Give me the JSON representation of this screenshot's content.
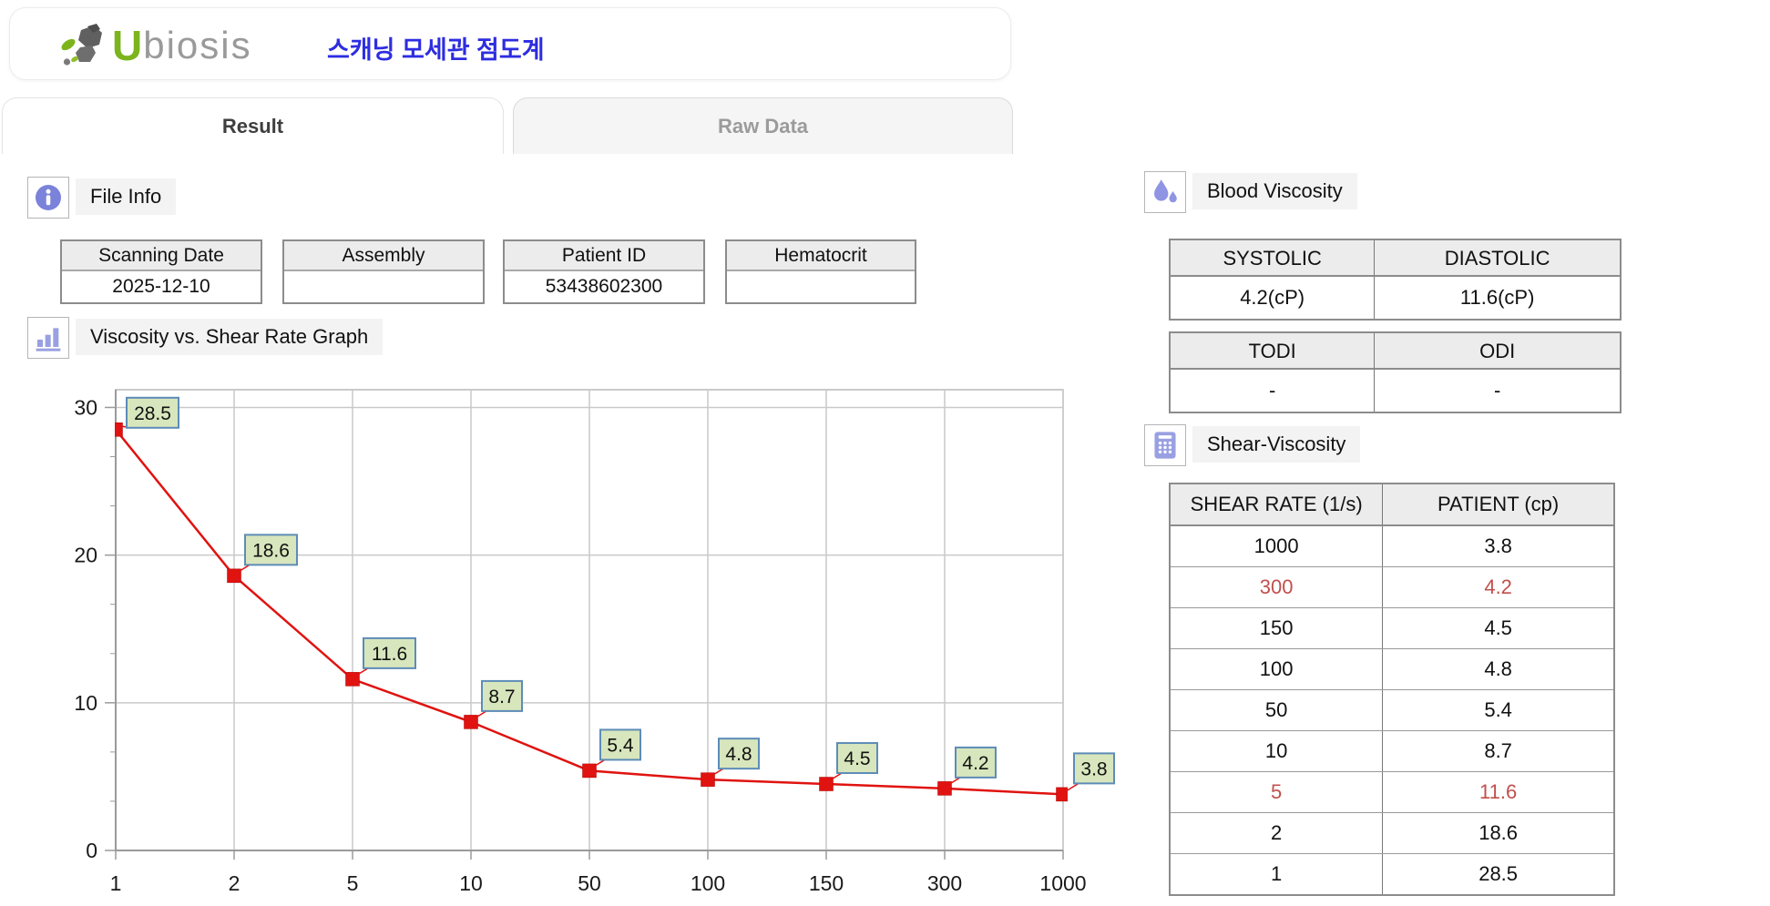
{
  "header": {
    "logo_u": "U",
    "logo_rest": "biosis",
    "app_title": "스캐닝 모세관 점도계"
  },
  "tabs": {
    "result": "Result",
    "raw_data": "Raw Data"
  },
  "file_info": {
    "title": "File Info",
    "fields": [
      {
        "label": "Scanning Date",
        "value": "2025-12-10"
      },
      {
        "label": "Assembly",
        "value": ""
      },
      {
        "label": "Patient ID",
        "value": "53438602300"
      },
      {
        "label": "Hematocrit",
        "value": ""
      }
    ]
  },
  "graph_section": {
    "title": "Viscosity vs. Shear Rate Graph"
  },
  "chart_data": {
    "type": "line",
    "categories": [
      "1",
      "2",
      "5",
      "10",
      "50",
      "100",
      "150",
      "300",
      "1000"
    ],
    "values": [
      28.5,
      18.6,
      11.6,
      8.7,
      5.4,
      4.8,
      4.5,
      4.2,
      3.8
    ],
    "data_labels": [
      "28.5",
      "18.6",
      "11.6",
      "8.7",
      "5.4",
      "4.8",
      "4.5",
      "4.2",
      "3.8"
    ],
    "yticks": [
      0,
      10,
      20,
      30
    ],
    "ylim": [
      0,
      31.2
    ],
    "grid": true,
    "legend": "none",
    "line_color": "#e01310",
    "marker": "square",
    "marker_color": "#e01310",
    "label_box_fill": "#d8e6bd",
    "label_box_border": "#5d8cb8",
    "grid_color": "#c9c9c9",
    "axis_color": "#9a9a9a",
    "tick_label_color": "#1a1a1a"
  },
  "blood_viscosity": {
    "title": "Blood Viscosity",
    "pressure_table": {
      "headers": [
        "SYSTOLIC",
        "DIASTOLIC"
      ],
      "values": [
        "4.2(cP)",
        "11.6(cP)"
      ]
    },
    "index_table": {
      "headers": [
        "TODI",
        "ODI"
      ],
      "values": [
        "-",
        "-"
      ]
    }
  },
  "shear_viscosity": {
    "title": "Shear-Viscosity",
    "headers": [
      "SHEAR RATE (1/s)",
      "PATIENT (cp)"
    ],
    "highlight_color": "#c0504d",
    "rows": [
      {
        "rate": "1000",
        "patient": "3.8",
        "highlight": false
      },
      {
        "rate": "300",
        "patient": "4.2",
        "highlight": true
      },
      {
        "rate": "150",
        "patient": "4.5",
        "highlight": false
      },
      {
        "rate": "100",
        "patient": "4.8",
        "highlight": false
      },
      {
        "rate": "50",
        "patient": "5.4",
        "highlight": false
      },
      {
        "rate": "10",
        "patient": "8.7",
        "highlight": false
      },
      {
        "rate": "5",
        "patient": "11.6",
        "highlight": true
      },
      {
        "rate": "2",
        "patient": "18.6",
        "highlight": false
      },
      {
        "rate": "1",
        "patient": "28.5",
        "highlight": false
      }
    ]
  }
}
